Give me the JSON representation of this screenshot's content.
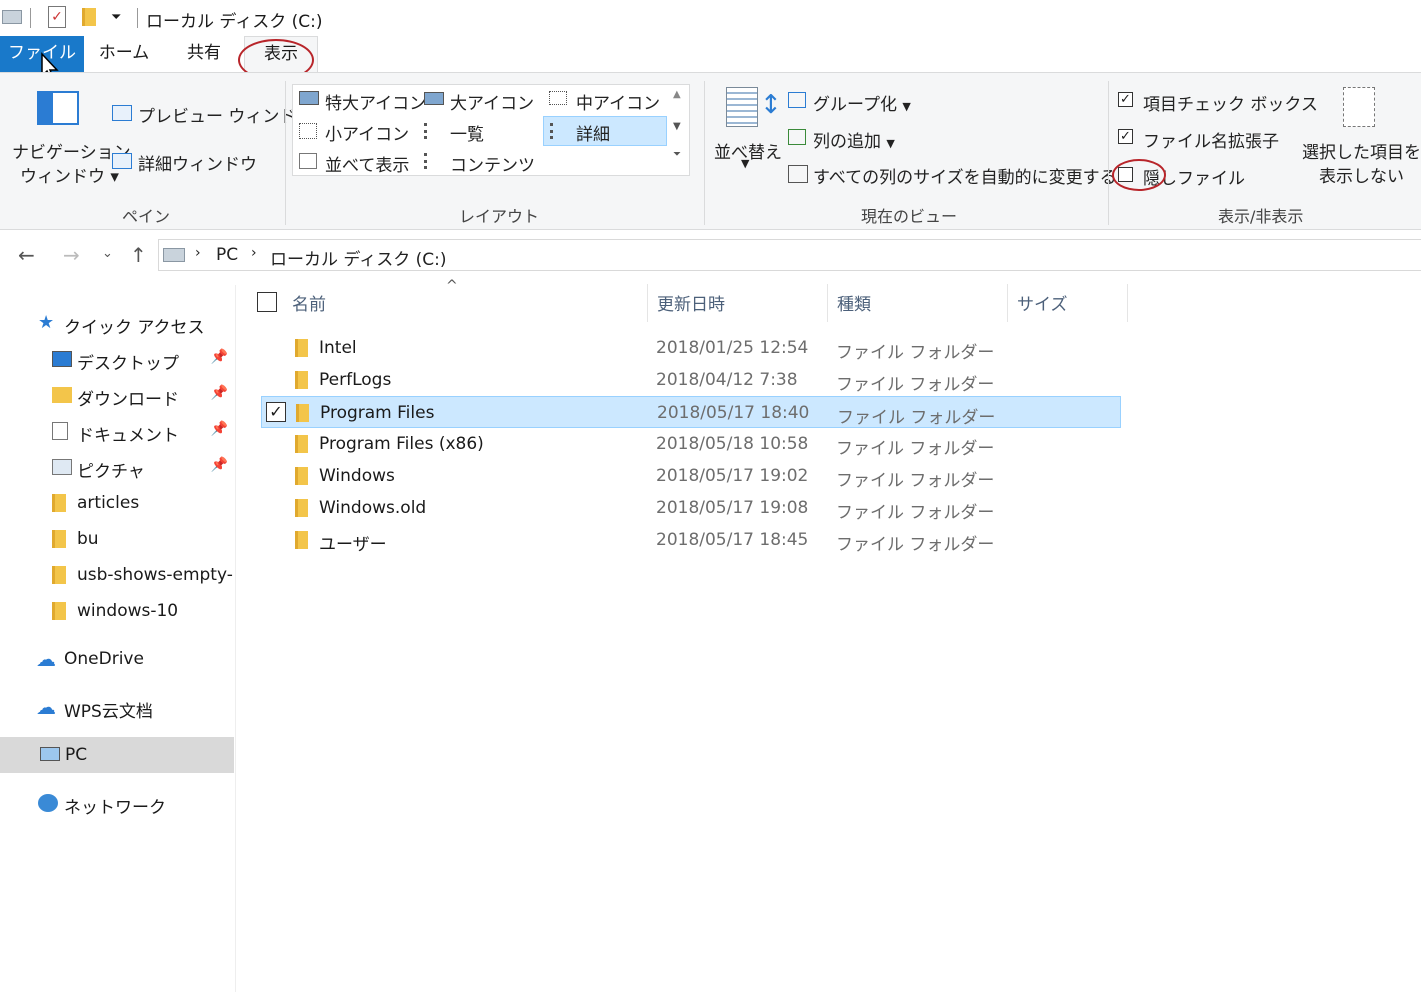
{
  "window": {
    "title": "ローカル ディスク (C:)"
  },
  "tabs": [
    {
      "label": "ファイル"
    },
    {
      "label": "ホーム"
    },
    {
      "label": "共有"
    },
    {
      "label": "表示"
    }
  ],
  "ribbon": {
    "pane": {
      "nav_pane_line1": "ナビゲーション",
      "nav_pane_line2": "ウィンドウ",
      "preview": "プレビュー ウィンドウ",
      "details": "詳細ウィンドウ",
      "group_label": "ペイン"
    },
    "layout": {
      "items": [
        "特大アイコン",
        "大アイコン",
        "中アイコン",
        "小アイコン",
        "一覧",
        "詳細",
        "並べて表示",
        "コンテンツ"
      ],
      "selected": "詳細",
      "group_label": "レイアウト"
    },
    "current_view": {
      "sort": "並べ替え",
      "group_by": "グループ化",
      "add_columns": "列の追加",
      "size_all_columns": "すべての列のサイズを自動的に変更する",
      "group_label": "現在のビュー"
    },
    "show_hide": {
      "item_checkboxes": "項目チェック ボックス",
      "item_checkboxes_checked": true,
      "file_extensions": "ファイル名拡張子",
      "file_extensions_checked": true,
      "hidden_items": "隠しファイル",
      "hidden_items_checked": false,
      "hide_selected_line1": "選択した項目を",
      "hide_selected_line2": "表示しない",
      "group_label": "表示/非表示"
    }
  },
  "address": {
    "crumbs": [
      "PC",
      "ローカル ディスク (C:)"
    ]
  },
  "nav": {
    "quick_access": "クイック アクセス",
    "items": [
      {
        "label": "デスクトップ",
        "pinned": true
      },
      {
        "label": "ダウンロード",
        "pinned": true
      },
      {
        "label": "ドキュメント",
        "pinned": true
      },
      {
        "label": "ピクチャ",
        "pinned": true
      },
      {
        "label": "articles"
      },
      {
        "label": "bu"
      },
      {
        "label": "usb-shows-empty-b"
      },
      {
        "label": "windows-10"
      }
    ],
    "onedrive": "OneDrive",
    "wps": "WPS云文档",
    "pc": "PC",
    "network": "ネットワーク"
  },
  "columns": [
    "名前",
    "更新日時",
    "種類",
    "サイズ"
  ],
  "files": [
    {
      "name": "Intel",
      "date": "2018/01/25 12:54",
      "type": "ファイル フォルダー"
    },
    {
      "name": "PerfLogs",
      "date": "2018/04/12 7:38",
      "type": "ファイル フォルダー"
    },
    {
      "name": "Program Files",
      "date": "2018/05/17 18:40",
      "type": "ファイル フォルダー",
      "selected": true
    },
    {
      "name": "Program Files (x86)",
      "date": "2018/05/18 10:58",
      "type": "ファイル フォルダー"
    },
    {
      "name": "Windows",
      "date": "2018/05/17 19:02",
      "type": "ファイル フォルダー"
    },
    {
      "name": "Windows.old",
      "date": "2018/05/17 19:08",
      "type": "ファイル フォルダー"
    },
    {
      "name": "ユーザー",
      "date": "2018/05/17 18:45",
      "type": "ファイル フォルダー"
    }
  ]
}
